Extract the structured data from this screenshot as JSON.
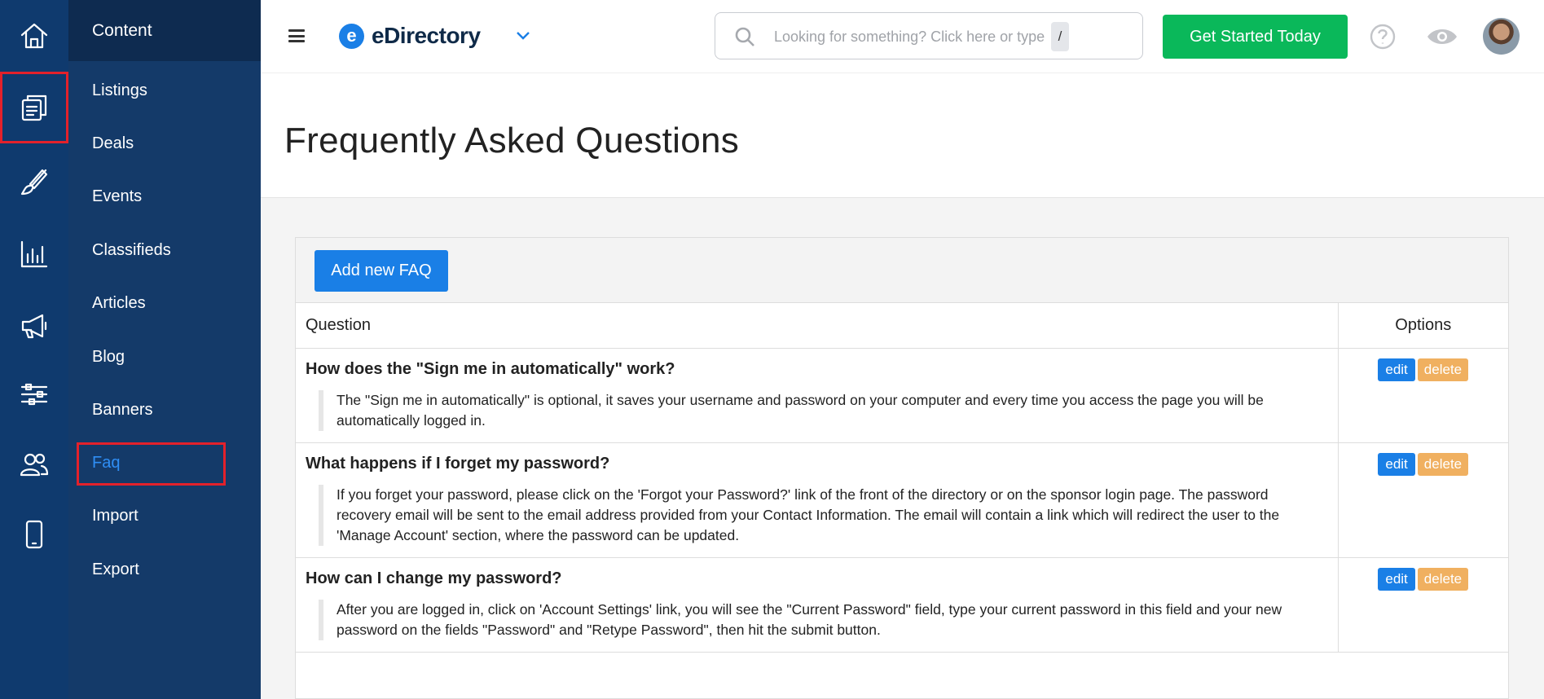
{
  "rail": {
    "items": [
      {
        "icon": "home-icon"
      },
      {
        "icon": "content-icon",
        "highlighted": true
      },
      {
        "icon": "brush-icon"
      },
      {
        "icon": "chart-icon"
      },
      {
        "icon": "megaphone-icon"
      },
      {
        "icon": "sliders-icon"
      },
      {
        "icon": "users-icon"
      },
      {
        "icon": "mobile-icon"
      }
    ]
  },
  "submenu": {
    "title": "Content",
    "items": [
      {
        "label": "Listings"
      },
      {
        "label": "Deals"
      },
      {
        "label": "Events"
      },
      {
        "label": "Classifieds"
      },
      {
        "label": "Articles"
      },
      {
        "label": "Blog"
      },
      {
        "label": "Banners"
      },
      {
        "label": "Faq",
        "active": true
      },
      {
        "label": "Import"
      },
      {
        "label": "Export"
      }
    ]
  },
  "topbar": {
    "logo_letter": "e",
    "logo_text": "eDirectory",
    "search_placeholder": "Looking for something? Click here or type",
    "search_shortcut": "/",
    "cta_label": "Get Started Today"
  },
  "page": {
    "title": "Frequently Asked Questions",
    "add_button": "Add new FAQ"
  },
  "table": {
    "headers": {
      "question": "Question",
      "options": "Options"
    },
    "edit_label": "edit",
    "delete_label": "delete",
    "rows": [
      {
        "question": "How does the \"Sign me in automatically\" work?",
        "answer": "The \"Sign me in automatically\" is optional, it saves your username and password on your computer and every time you access the page you will be automatically logged in."
      },
      {
        "question": "What happens if I forget my password?",
        "answer": "If you forget your password, please click on the 'Forgot your Password?' link of the front of the directory or on the sponsor login page. The password recovery email will be sent to the email address provided from your Contact Information. The email will contain a link which will redirect the user to the 'Manage Account' section, where the password can be updated."
      },
      {
        "question": "How can I change my password?",
        "answer": "After you are logged in, click on 'Account Settings' link, you will see the \"Current Password\" field, type your current password in this field and your new password on the fields \"Password\" and \"Retype Password\", then hit the submit button."
      }
    ]
  },
  "colors": {
    "rail_bg": "#0f3a6e",
    "submenu_bg": "#143a69",
    "accent": "#1a7fe6",
    "cta": "#0ab85a",
    "delete": "#f0b060",
    "highlight_box": "#e3212b"
  }
}
